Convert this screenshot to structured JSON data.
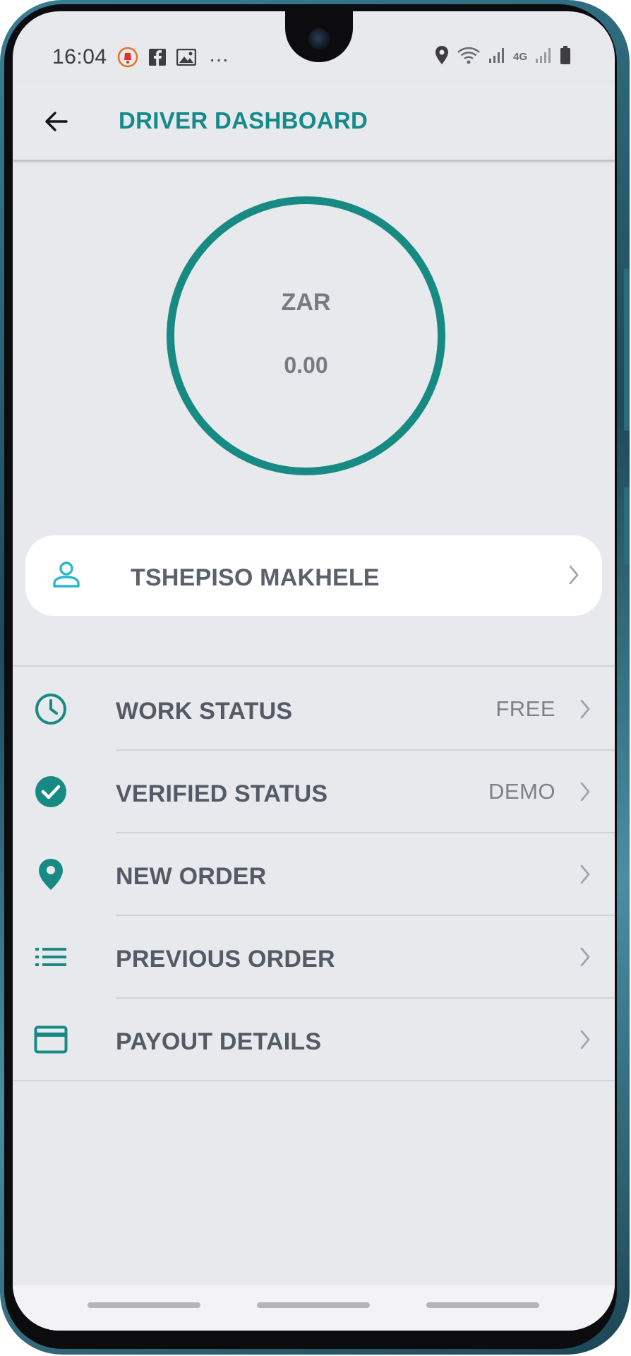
{
  "status_bar": {
    "time": "16:04",
    "more": "···",
    "network": "4G"
  },
  "app_bar": {
    "title": "DRIVER DASHBOARD"
  },
  "balance": {
    "currency": "ZAR",
    "amount": "0.00"
  },
  "profile": {
    "name": "TSHEPISO MAKHELE"
  },
  "menu": {
    "items": [
      {
        "icon": "clock-icon",
        "label": "WORK STATUS",
        "value": "FREE"
      },
      {
        "icon": "check-circle-icon",
        "label": "VERIFIED STATUS",
        "value": "DEMO"
      },
      {
        "icon": "location-pin-icon",
        "label": "NEW ORDER",
        "value": ""
      },
      {
        "icon": "list-icon",
        "label": "PREVIOUS ORDER",
        "value": ""
      },
      {
        "icon": "credit-card-icon",
        "label": "PAYOUT DETAILS",
        "value": ""
      }
    ]
  },
  "colors": {
    "accent": "#178a84",
    "title": "#158a8a",
    "profile_icon": "#2ab7c9",
    "background": "#e8e9ec"
  }
}
